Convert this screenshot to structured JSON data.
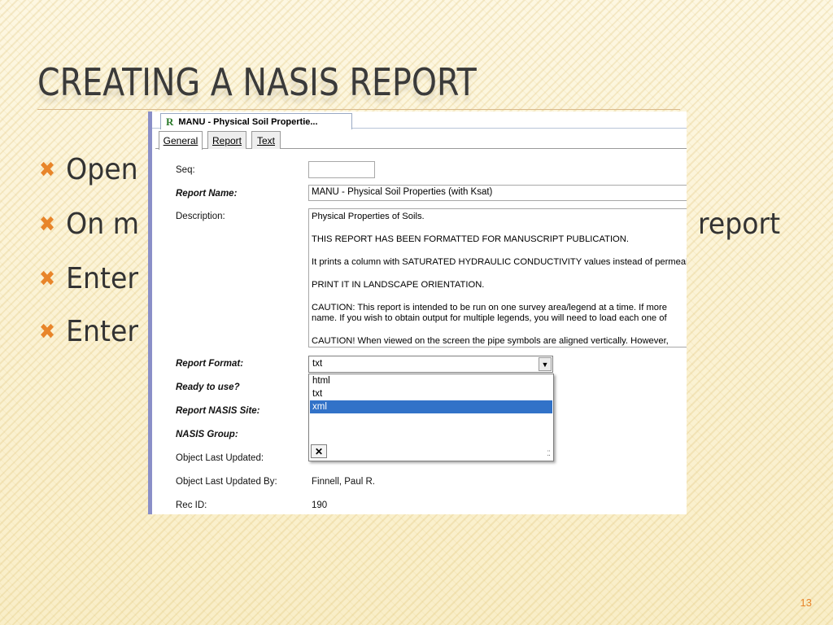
{
  "slide": {
    "title": "Creating a NASIS report",
    "page_number": "13",
    "bullets": [
      {
        "text": "Open"
      },
      {
        "text": "On m",
        "right_text": "report"
      },
      {
        "text": "Enter"
      },
      {
        "text": "Enter"
      }
    ],
    "bullet_color": "#e8852a"
  },
  "window": {
    "doc_tab_icon": "R",
    "doc_tab_title": "MANU - Physical Soil Propertie...",
    "tabs": [
      {
        "label": "General",
        "active": true
      },
      {
        "label": "Report",
        "active": false
      },
      {
        "label": "Text",
        "active": false
      }
    ],
    "form": {
      "seq_label": "Seq:",
      "seq_value": "",
      "report_name_label": "Report Name:",
      "report_name_value": "MANU - Physical Soil Properties (with Ksat)",
      "description_label": "Description:",
      "description_lines": [
        "Physical Properties of Soils.",
        "THIS REPORT HAS BEEN FORMATTED FOR MANUSCRIPT PUBLICATION.",
        "It prints a column with SATURATED HYDRAULIC CONDUCTIVITY values instead of permeal",
        "PRINT IT IN LANDSCAPE ORIENTATION.",
        "CAUTION:  This report is intended to be run on one survey area/legend at a time.  If more",
        "name.  If you wish to obtain output for multiple legends, you will need to load each one of",
        "CAUTION! When viewed on the screen the pipe symbols are aligned vertically.  However,"
      ],
      "report_format_label": "Report Format:",
      "report_format_value": "txt",
      "report_format_options": [
        "html",
        "txt",
        "xml"
      ],
      "report_format_highlighted": "xml",
      "close_glyph": "✕",
      "ready_label": "Ready to use?",
      "site_label": "Report NASIS Site:",
      "group_label": "NASIS Group:",
      "last_updated_label": "Object Last Updated:",
      "last_updated_by_label": "Object Last Updated By:",
      "last_updated_by_value": "Finnell, Paul R.",
      "rec_id_label": "Rec ID:",
      "rec_id_value": "190"
    }
  }
}
